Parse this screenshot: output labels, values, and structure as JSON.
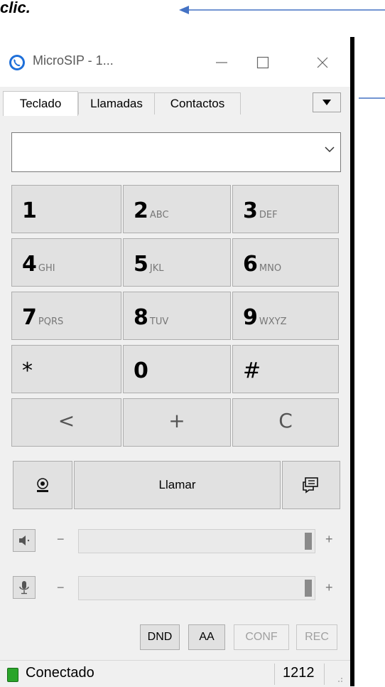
{
  "caption": "clic.",
  "window": {
    "title": "MicroSIP - 1...",
    "minimize_glyph": "—",
    "maximize_glyph": "☐",
    "close_glyph": "✕"
  },
  "tabs": [
    {
      "label": "Teclado",
      "active": true
    },
    {
      "label": "Llamadas",
      "active": false
    },
    {
      "label": "Contactos",
      "active": false
    }
  ],
  "number_input": {
    "value": "",
    "placeholder": ""
  },
  "keypad": [
    {
      "digit": "1",
      "letters": ""
    },
    {
      "digit": "2",
      "letters": "ABC"
    },
    {
      "digit": "3",
      "letters": "DEF"
    },
    {
      "digit": "4",
      "letters": "GHI"
    },
    {
      "digit": "5",
      "letters": "JKL"
    },
    {
      "digit": "6",
      "letters": "MNO"
    },
    {
      "digit": "7",
      "letters": "PQRS"
    },
    {
      "digit": "8",
      "letters": "TUV"
    },
    {
      "digit": "9",
      "letters": "WXYZ"
    },
    {
      "digit": "*",
      "letters": ""
    },
    {
      "digit": "0",
      "letters": ""
    },
    {
      "digit": "#",
      "letters": ""
    }
  ],
  "controls": {
    "backspace": "<",
    "plus": "+",
    "clear": "C"
  },
  "call_button": "Llamar",
  "sliders": {
    "speaker": {
      "minus": "−",
      "plus": "+",
      "level": 1.0
    },
    "microphone": {
      "minus": "−",
      "plus": "+",
      "level": 1.0
    }
  },
  "toggles": [
    {
      "label": "DND",
      "enabled": true
    },
    {
      "label": "AA",
      "enabled": true
    },
    {
      "label": "CONF",
      "enabled": false
    },
    {
      "label": "REC",
      "enabled": false
    }
  ],
  "status": {
    "text": "Conectado",
    "extension": "1212",
    "color": "#2aa52a"
  },
  "icons": {
    "app": "microsip-logo-icon",
    "video": "webcam-icon",
    "message": "chat-message-icon",
    "speaker": "speaker-icon",
    "microphone": "microphone-icon"
  },
  "accent_color": "#4472c4"
}
